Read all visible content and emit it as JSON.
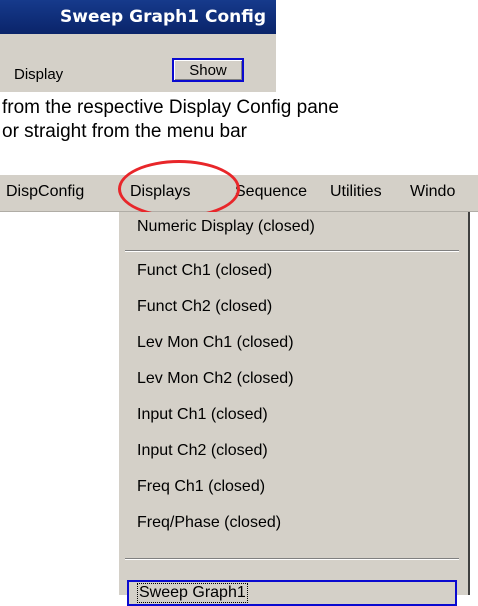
{
  "config_panel": {
    "title": "Sweep Graph1 Config",
    "row_label": "Display",
    "show_button": "Show"
  },
  "caption": {
    "line1": "from the respective Display Config pane",
    "line2": "or straight from the menu bar"
  },
  "menubar": {
    "items": [
      "DispConfig",
      "Displays",
      "Sequence",
      "Utilities",
      "Windo"
    ]
  },
  "dropdown": {
    "items": [
      "Numeric Display (closed)",
      "Funct Ch1 (closed)",
      "Funct Ch2 (closed)",
      "Lev Mon Ch1 (closed)",
      "Lev Mon Ch2 (closed)",
      "Input Ch1 (closed)",
      "Input Ch2 (closed)",
      "Freq Ch1 (closed)",
      "Freq/Phase (closed)",
      "Sweep Graph1"
    ]
  },
  "colors": {
    "titlebar": "#0a246a",
    "highlight": "#e8262a",
    "focus_border": "#0a0ad0",
    "panel_bg": "#d4d0c8"
  }
}
